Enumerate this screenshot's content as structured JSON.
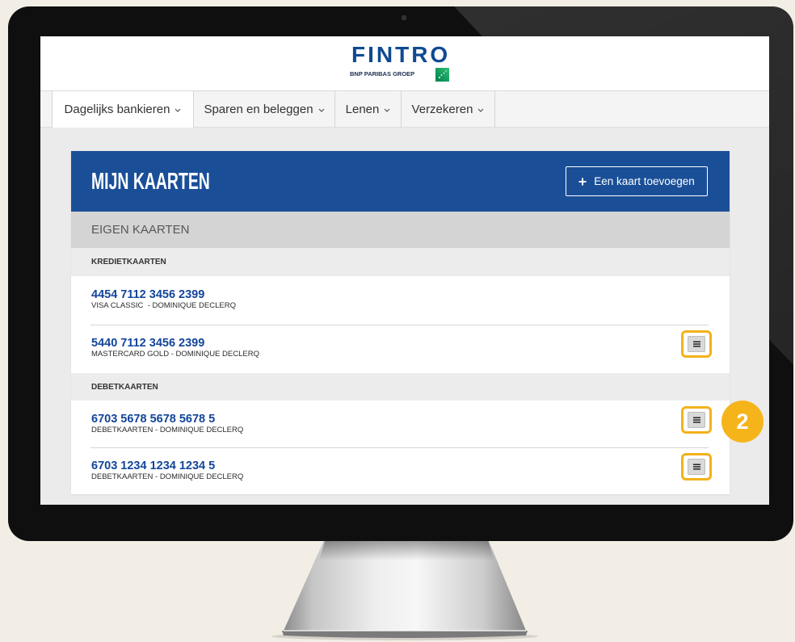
{
  "brand": {
    "name": "FINTRO",
    "tagline": "BNP PARIBAS GROEP",
    "logo_icon": "bnp-paribas-logo-icon",
    "primary_color": "#0f4a92",
    "logo_green": "#00965e"
  },
  "nav": {
    "items": [
      {
        "label": "Dagelijks bankieren",
        "active": true
      },
      {
        "label": "Sparen en beleggen",
        "active": false
      },
      {
        "label": "Lenen",
        "active": false
      },
      {
        "label": "Verzekeren",
        "active": false
      }
    ],
    "dropdown_icon": "chevron-down-icon"
  },
  "panel": {
    "title": "MIJN KAARTEN",
    "header_color": "#1a4f98",
    "add_button": {
      "icon": "plus-icon",
      "label": "Een kaart toevoegen"
    },
    "section_title": "EIGEN KAARTEN",
    "menu_icon": "menu-icon",
    "groups": [
      {
        "title": "KREDIETKAARTEN",
        "cards": [
          {
            "number": "4454 7112 3456 2399",
            "description": "VISA CLASSIC  - DOMINIQUE DECLERQ",
            "menu": false
          },
          {
            "number": "5440 7112 3456 2399",
            "description": "MASTERCARD GOLD - DOMINIQUE DECLERQ",
            "menu": true
          }
        ]
      },
      {
        "title": "DEBETKAARTEN",
        "cards": [
          {
            "number": "6703 5678 5678 5678 5",
            "description": "DEBETKAARTEN - DOMINIQUE DECLERQ",
            "menu": true
          },
          {
            "number": "6703 1234 1234 1234 5",
            "description": "DEBETKAARTEN - DOMINIQUE DECLERQ",
            "menu": true
          }
        ]
      }
    ]
  },
  "annotation": {
    "step_number": "2",
    "highlight_color": "#f3b21b",
    "badge_color": "#f5b41a"
  }
}
